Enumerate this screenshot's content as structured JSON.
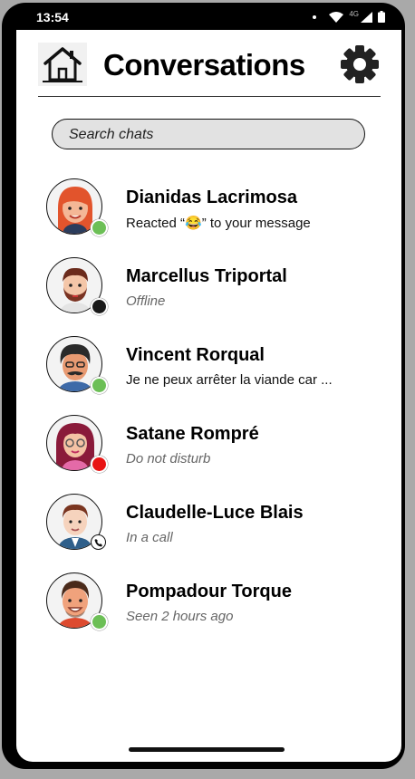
{
  "status_bar": {
    "time": "13:54",
    "network": "4G"
  },
  "header": {
    "title": "Conversations"
  },
  "search": {
    "placeholder": "Search chats"
  },
  "colors": {
    "online": "#6cbf56",
    "offline": "#1a1a1a",
    "busy": "#e81313"
  },
  "chats": [
    {
      "name": "Dianidas Lacrimosa",
      "status": "Reacted “😂” to  your message",
      "presence": "online",
      "avatar": "red-haired-woman-avatar"
    },
    {
      "name": "Marcellus Triportal",
      "status": "Offline",
      "presence": "offline",
      "avatar": "bearded-man-avatar"
    },
    {
      "name": "Vincent Rorqual",
      "status": "Je ne peux arrêter la viande car ...",
      "presence": "online",
      "avatar": "mustached-man-avatar"
    },
    {
      "name": "Satane Rompré",
      "status": "Do not disturb",
      "presence": "busy",
      "avatar": "glasses-woman-avatar"
    },
    {
      "name": "Claudelle-Luce Blais",
      "status": "In a call",
      "presence": "in-call",
      "avatar": "suited-man-avatar"
    },
    {
      "name": "Pompadour Torque",
      "status": "Seen 2 hours ago",
      "presence": "online",
      "avatar": "smiling-man-avatar"
    }
  ]
}
